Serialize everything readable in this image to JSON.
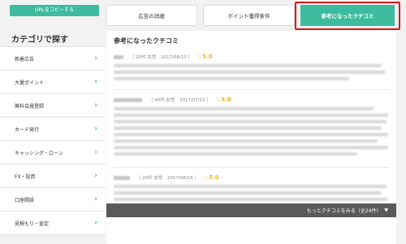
{
  "sidebar": {
    "copy_url_label": "URLをコピーする",
    "category_title": "カテゴリで探す",
    "items": [
      {
        "label": "新着広告"
      },
      {
        "label": "大量ポイント"
      },
      {
        "label": "無料会員登録"
      },
      {
        "label": "カード発行"
      },
      {
        "label": "キャッシング・ローン"
      },
      {
        "label": "FX・投資"
      },
      {
        "label": "口座開設"
      },
      {
        "label": "見積もり・査定"
      }
    ]
  },
  "tabs": [
    {
      "label": "広告の詳細"
    },
    {
      "label": "ポイント獲得条件"
    },
    {
      "label": "参考になったクチコミ"
    }
  ],
  "reviews_panel": {
    "title": "参考になったクチコミ",
    "reviews": [
      {
        "meta": "（ 20代 女性　2017/08/15 ）",
        "rating": "☆5.0"
      },
      {
        "meta": "（ 40代 女性　2017/07/12 ）",
        "rating": "☆3.0"
      },
      {
        "meta": "（ 20代 女性　2017/06/16 ）",
        "rating": "☆5.0"
      }
    ],
    "more_label": "もっとクチコミをみる（全24件）"
  },
  "colors": {
    "accent": "#3dbb9e",
    "highlight": "#d7161c",
    "rating": "#f2b01e"
  }
}
